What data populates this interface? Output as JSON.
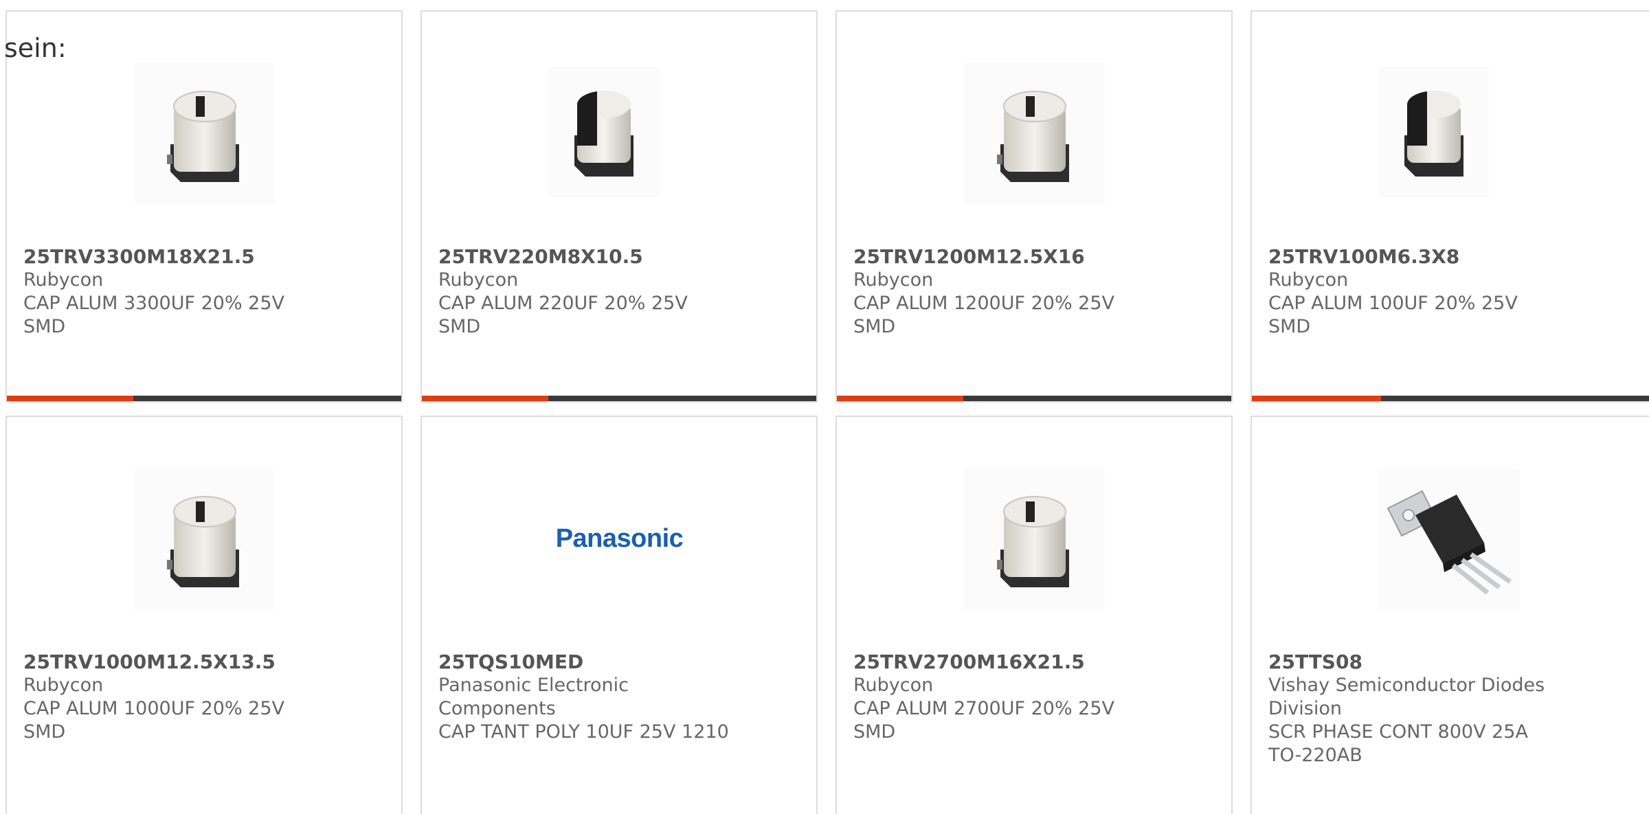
{
  "intro_text": "sein:",
  "colors": {
    "accent": "#e23b12",
    "bar_track": "#3a3a3a",
    "card_border": "#dcdcdc",
    "panasonic_blue": "#1b5fae"
  },
  "products": [
    {
      "part": "25TRV3300M18X21.5",
      "manufacturer": "Rubycon",
      "description": "CAP ALUM 3300UF 20% 25V SMD",
      "image": "capacitor-icon",
      "progress": 0.32
    },
    {
      "part": "25TRV220M8X10.5",
      "manufacturer": "Rubycon",
      "description": "CAP ALUM 220UF 20% 25V SMD",
      "image": "capacitor-icon",
      "progress": 0.32
    },
    {
      "part": "25TRV1200M12.5X16",
      "manufacturer": "Rubycon",
      "description": "CAP ALUM 1200UF 20% 25V SMD",
      "image": "capacitor-icon",
      "progress": 0.32
    },
    {
      "part": "25TRV100M6.3X8",
      "manufacturer": "Rubycon",
      "description": "CAP ALUM 100UF 20% 25V SMD",
      "image": "capacitor-icon",
      "progress": 0.32
    },
    {
      "part": "25TRV1000M12.5X13.5",
      "manufacturer": "Rubycon",
      "description": "CAP ALUM 1000UF 20% 25V SMD",
      "image": "capacitor-icon"
    },
    {
      "part": "25TQS10MED",
      "manufacturer": "Panasonic Electronic Components",
      "description": "CAP TANT POLY 10UF 25V 1210",
      "image": "panasonic-logo",
      "brand_text": "Panasonic"
    },
    {
      "part": "25TRV2700M16X21.5",
      "manufacturer": "Rubycon",
      "description": "CAP ALUM 2700UF 20% 25V SMD",
      "image": "capacitor-icon"
    },
    {
      "part": "25TTS08",
      "manufacturer": "Vishay Semiconductor Diodes Division",
      "description": "SCR PHASE CONT 800V 25A TO-220AB",
      "image": "to220-transistor-icon"
    }
  ]
}
